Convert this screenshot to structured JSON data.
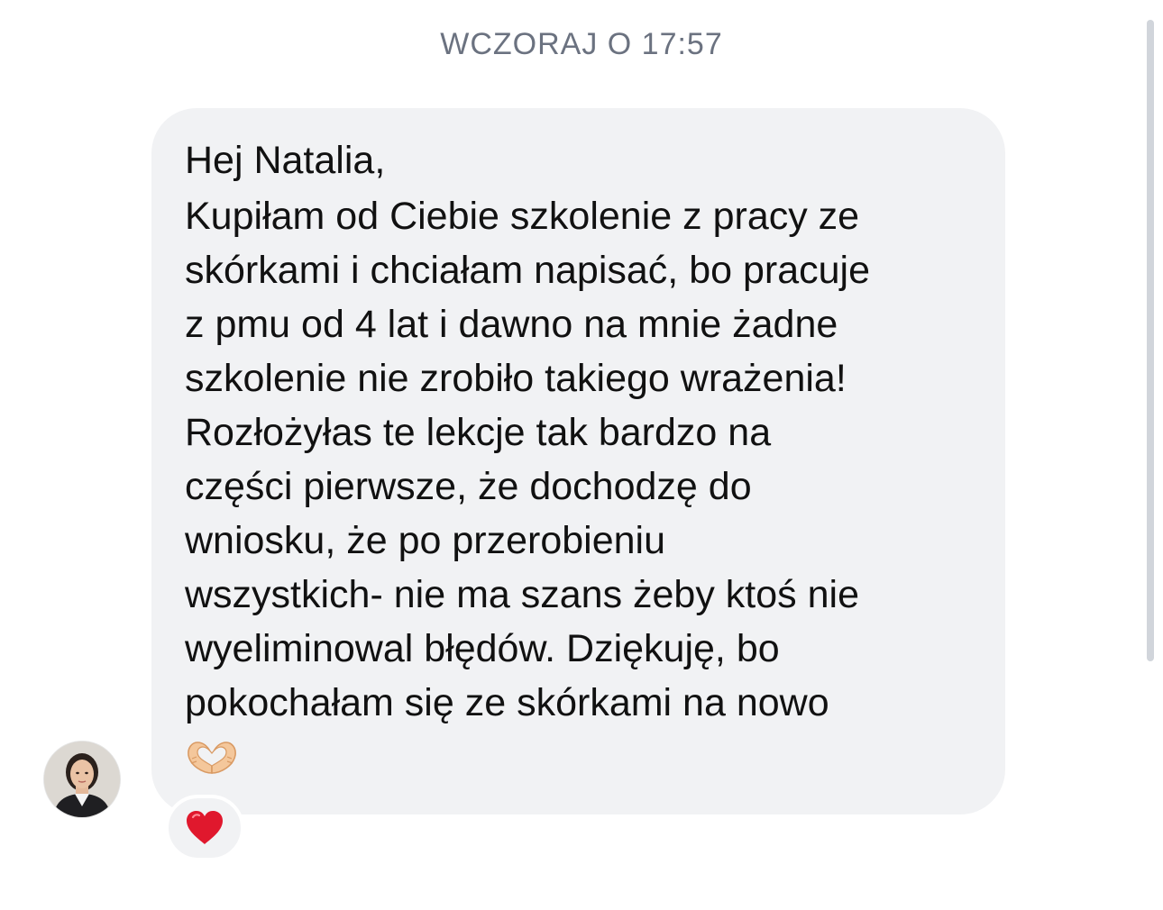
{
  "header": {
    "timestamp": "WCZORAJ O 17:57"
  },
  "message": {
    "greeting": "Hej Natalia,",
    "lines": [
      "Kupiłam od Ciebie szkolenie z pracy ze",
      "skórkami i chciałam napisać, bo pracuje",
      "z pmu od 4 lat i dawno na mnie żadne",
      "szkolenie nie zrobiło takiego wrażenia!",
      "Rozłożyłas te lekcje tak bardzo na",
      "części pierwsze, że dochodzę do",
      "wniosku, że po przerobieniu",
      "wszystkich- nie ma szans żeby ktoś nie",
      "wyeliminowal błędów. Dziękuję, bo",
      "pokochałam się ze skórkami na nowo"
    ],
    "trailing_emoji_icon": "heart-hands-icon"
  },
  "sender": {
    "avatar_icon": "avatar"
  },
  "reaction": {
    "icon": "red-heart-icon"
  },
  "colors": {
    "bubble_bg": "#f1f2f4",
    "timestamp_text": "#6b7280",
    "message_text": "#111111",
    "reaction_heart": "#e0182d"
  }
}
